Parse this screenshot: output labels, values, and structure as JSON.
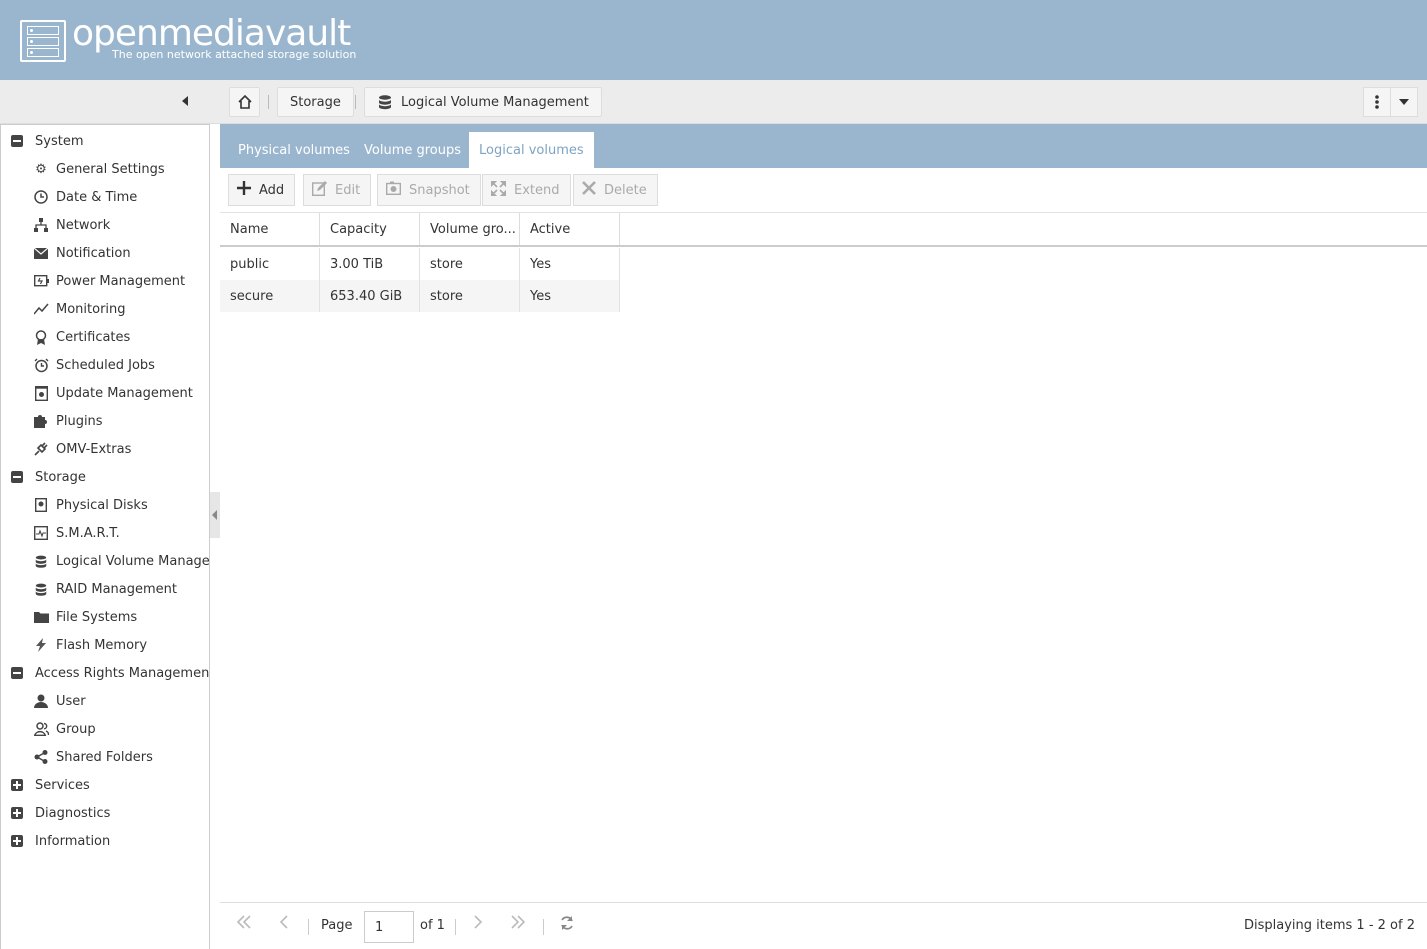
{
  "app": {
    "name": "openmediavault",
    "tagline": "The open network attached storage solution"
  },
  "breadcrumb": {
    "home_icon": "home-icon",
    "items": [
      "Storage",
      "Logical Volume Management"
    ]
  },
  "sidebar": {
    "groups": [
      {
        "label": "System",
        "expanded": true,
        "items": [
          {
            "label": "General Settings",
            "icon": "gears-icon"
          },
          {
            "label": "Date & Time",
            "icon": "clock-icon"
          },
          {
            "label": "Network",
            "icon": "network-icon"
          },
          {
            "label": "Notification",
            "icon": "envelope-icon"
          },
          {
            "label": "Power Management",
            "icon": "power-icon"
          },
          {
            "label": "Monitoring",
            "icon": "chart-line-icon"
          },
          {
            "label": "Certificates",
            "icon": "certificate-icon"
          },
          {
            "label": "Scheduled Jobs",
            "icon": "alarm-clock-icon"
          },
          {
            "label": "Update Management",
            "icon": "update-icon"
          },
          {
            "label": "Plugins",
            "icon": "puzzle-icon"
          },
          {
            "label": "OMV-Extras",
            "icon": "plug-icon"
          }
        ]
      },
      {
        "label": "Storage",
        "expanded": true,
        "items": [
          {
            "label": "Physical Disks",
            "icon": "disk-icon"
          },
          {
            "label": "S.M.A.R.T.",
            "icon": "pulse-icon"
          },
          {
            "label": "Logical Volume Managem",
            "icon": "database-icon"
          },
          {
            "label": "RAID Management",
            "icon": "database-icon"
          },
          {
            "label": "File Systems",
            "icon": "folder-icon"
          },
          {
            "label": "Flash Memory",
            "icon": "flash-icon"
          }
        ]
      },
      {
        "label": "Access Rights Management",
        "expanded": true,
        "items": [
          {
            "label": "User",
            "icon": "user-icon"
          },
          {
            "label": "Group",
            "icon": "users-icon"
          },
          {
            "label": "Shared Folders",
            "icon": "share-icon"
          }
        ]
      },
      {
        "label": "Services",
        "expanded": false,
        "items": []
      },
      {
        "label": "Diagnostics",
        "expanded": false,
        "items": []
      },
      {
        "label": "Information",
        "expanded": false,
        "items": []
      }
    ]
  },
  "tabs": [
    {
      "label": "Physical volumes",
      "active": false
    },
    {
      "label": "Volume groups",
      "active": false
    },
    {
      "label": "Logical volumes",
      "active": true
    }
  ],
  "actions": [
    {
      "label": "Add",
      "icon": "plus-icon",
      "enabled": true
    },
    {
      "label": "Edit",
      "icon": "edit-icon",
      "enabled": false
    },
    {
      "label": "Snapshot",
      "icon": "camera-icon",
      "enabled": false
    },
    {
      "label": "Extend",
      "icon": "expand-icon",
      "enabled": false
    },
    {
      "label": "Delete",
      "icon": "times-icon",
      "enabled": false
    }
  ],
  "grid": {
    "columns": [
      "Name",
      "Capacity",
      "Volume gro...",
      "Active"
    ],
    "rows": [
      [
        "public",
        "3.00 TiB",
        "store",
        "Yes"
      ],
      [
        "secure",
        "653.40 GiB",
        "store",
        "Yes"
      ]
    ]
  },
  "pager": {
    "page_label": "Page",
    "page_value": "1",
    "of_label": "of 1",
    "status": "Displaying items 1 - 2 of 2"
  },
  "colors": {
    "header_bg": "#9ab6cf",
    "active_tab_text": "#7fa3c2"
  }
}
